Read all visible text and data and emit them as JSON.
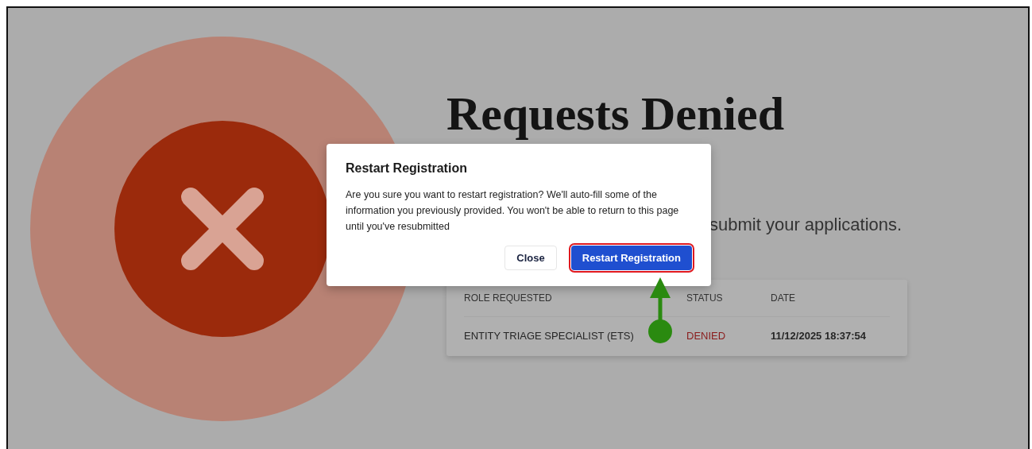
{
  "page": {
    "title": "Requests Denied",
    "subtitle": "submit your applications."
  },
  "table": {
    "columns": [
      "ROLE REQUESTED",
      "STATUS",
      "DATE"
    ],
    "rows": [
      {
        "role": "ENTITY TRIAGE SPECIALIST (ETS)",
        "status": "DENIED",
        "date": "11/12/2025 18:37:54"
      }
    ]
  },
  "dialog": {
    "title": "Restart Registration",
    "message": "Are you sure you want to restart registration? We'll auto-fill some of the information you previously provided. You won't be able to return to this page until you've resubmitted",
    "buttons": [
      {
        "label": "Close",
        "kind": "secondary",
        "highlighted": false
      },
      {
        "label": "Restart Registration",
        "kind": "primary",
        "highlighted": true
      }
    ]
  }
}
